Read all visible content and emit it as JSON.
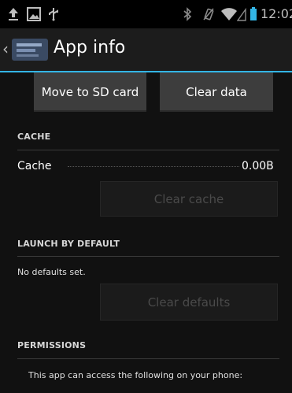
{
  "status_bar": {
    "time": "12:02",
    "icons": [
      "upload-icon",
      "image-icon",
      "usb-icon",
      "bluetooth-icon",
      "vibrate-icon",
      "wifi-icon",
      "signal-icon",
      "battery-icon"
    ],
    "accent_color": "#33b5e5"
  },
  "action_bar": {
    "title": "App info"
  },
  "buttons": {
    "move_to_sd": "Move to SD card",
    "clear_data": "Clear data",
    "clear_cache": "Clear cache",
    "clear_defaults": "Clear defaults"
  },
  "cache": {
    "header": "CACHE",
    "label": "Cache",
    "value": "0.00B"
  },
  "launch_default": {
    "header": "LAUNCH BY DEFAULT",
    "text": "No defaults set."
  },
  "permissions": {
    "header": "PERMISSIONS",
    "text": "This app can access the following on your phone:"
  }
}
